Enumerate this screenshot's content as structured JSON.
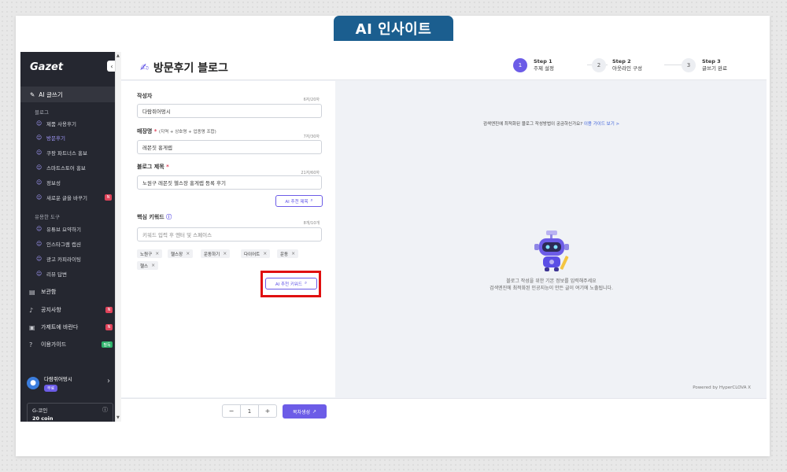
{
  "banner": {
    "title": "AI 인사이트"
  },
  "sidebar": {
    "logo": "Gazet",
    "active_nav": "AI 글쓰기",
    "section_blog": "블로그",
    "blog_items": [
      {
        "label": "제품 사용후기",
        "active": false
      },
      {
        "label": "방문후기",
        "active": true
      },
      {
        "label": "쿠팡 파트너스 홍보",
        "active": false
      },
      {
        "label": "스마트스토어 홍보",
        "active": false
      },
      {
        "label": "정보성",
        "active": false
      },
      {
        "label": "새로운 글을 바꾸기",
        "active": false,
        "badge": "N"
      }
    ],
    "section_tools": "유용한 도구",
    "tool_items": [
      {
        "label": "유튜브 요약하기"
      },
      {
        "label": "인스타그램 캡션"
      },
      {
        "label": "광고 카피라이팅"
      },
      {
        "label": "리뷰 답변"
      }
    ],
    "main_items": [
      {
        "label": "보관함",
        "icon": "archive-icon"
      },
      {
        "label": "공지사항",
        "icon": "bell-icon",
        "badge": "N"
      },
      {
        "label": "가제트에 바란다",
        "icon": "message-icon",
        "badge": "N"
      },
      {
        "label": "이용가이드",
        "icon": "question-icon",
        "badge": "필독"
      }
    ],
    "user": {
      "name": "다람쥐어멍시",
      "tag": "무료"
    },
    "coin": {
      "label": "G-코인",
      "value": "20 coin"
    }
  },
  "header": {
    "title": "방문후기 블로그",
    "steps": [
      {
        "num": "1",
        "step": "Step 1",
        "label": "주제 설정",
        "active": true
      },
      {
        "num": "2",
        "step": "Step 2",
        "label": "아웃라인 구성",
        "active": false
      },
      {
        "num": "3",
        "step": "Step 3",
        "label": "글쓰기 완료",
        "active": false
      }
    ]
  },
  "form": {
    "author": {
      "label": "작성자",
      "count": "6자/20자",
      "value": "다람쥐어멍시"
    },
    "store": {
      "label": "매장명",
      "hint": "(지역 + 상호명 + 업종명 조합)",
      "count": "7자/30자",
      "value": "레몬짓 홍게렙"
    },
    "blog_title": {
      "label": "블로그 제목",
      "count": "21자/60자",
      "value": "노원구 레몬짓 헬스장 홍게렙 등록 후기",
      "ai_button": "AI 추천 제목"
    },
    "keywords": {
      "label": "핵심 키워드",
      "count": "8개/10개",
      "placeholder": "키워드 입력 후 엔터 및 스페이스",
      "chips": [
        "노원구",
        "헬스장",
        "운동하기",
        "다이어트",
        "운동",
        "헬스"
      ],
      "ai_button": "AI 추천 키워드"
    }
  },
  "preview": {
    "hint": "검색엔진에 최적화된 블로그 작성방법이 궁금하신가요?",
    "hint_link": "이용 가이드 보기 >",
    "empty_line1": "블로그 작성을 위한 기본 정보를 입력해주세요",
    "empty_line2": "검색엔진에 최적화된 인공지능이 만든 글이 여기에 노출됩니다.",
    "powered": "Powered by HyperCLOVA X"
  },
  "bottom": {
    "quantity": "1",
    "generate_button": "목차생성"
  },
  "colors": {
    "accent": "#6c5ce7",
    "banner": "#1b5e8f",
    "highlight": "#e01010"
  }
}
